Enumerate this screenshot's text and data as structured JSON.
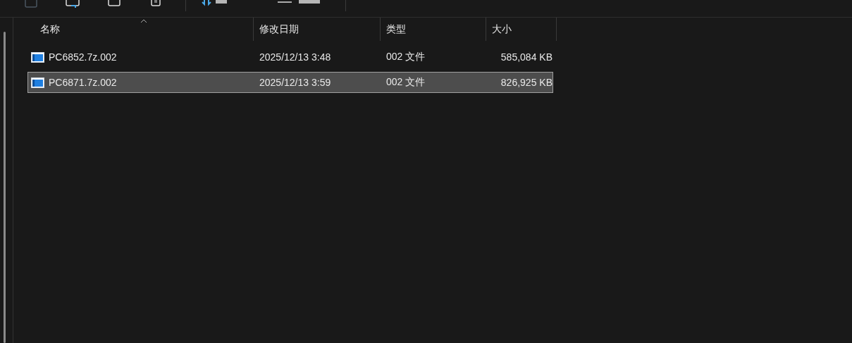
{
  "columns": [
    {
      "label": "名称",
      "sorted": true
    },
    {
      "label": "修改日期",
      "sorted": false
    },
    {
      "label": "类型",
      "sorted": false
    },
    {
      "label": "大小",
      "sorted": false
    }
  ],
  "rows": [
    {
      "name": "PC6852.7z.002",
      "date": "2025/12/13 3:48",
      "type": "002 文件",
      "size": "585,084 KB",
      "selected": false
    },
    {
      "name": "PC6871.7z.002",
      "date": "2025/12/13 3:59",
      "type": "002 文件",
      "size": "826,925 KB",
      "selected": true
    }
  ]
}
